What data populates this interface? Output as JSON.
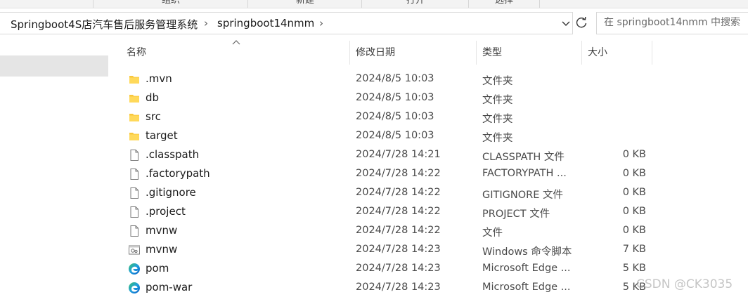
{
  "ribbon": {
    "groups": [
      "组织",
      "新建",
      "打开",
      "选择"
    ]
  },
  "address_bar": {
    "breadcrumbs": [
      "Springboot4S店汽车售后服务管理系统",
      "springboot14nmm"
    ]
  },
  "search": {
    "placeholder": "在 springboot14nmm 中搜索"
  },
  "columns": {
    "name": "名称",
    "date": "修改日期",
    "type": "类型",
    "size": "大小"
  },
  "files": [
    {
      "name": ".mvn",
      "date": "2024/8/5 10:03",
      "type": "文件夹",
      "size": "",
      "icon": "folder-icon"
    },
    {
      "name": "db",
      "date": "2024/8/5 10:03",
      "type": "文件夹",
      "size": "",
      "icon": "folder-icon"
    },
    {
      "name": "src",
      "date": "2024/8/5 10:03",
      "type": "文件夹",
      "size": "",
      "icon": "folder-icon"
    },
    {
      "name": "target",
      "date": "2024/8/5 10:03",
      "type": "文件夹",
      "size": "",
      "icon": "folder-icon"
    },
    {
      "name": ".classpath",
      "date": "2024/7/28 14:21",
      "type": "CLASSPATH 文件",
      "size": "0 KB",
      "icon": "file-icon"
    },
    {
      "name": ".factorypath",
      "date": "2024/7/28 14:22",
      "type": "FACTORYPATH ...",
      "size": "0 KB",
      "icon": "file-icon"
    },
    {
      "name": ".gitignore",
      "date": "2024/7/28 14:22",
      "type": "GITIGNORE 文件",
      "size": "0 KB",
      "icon": "file-icon"
    },
    {
      "name": ".project",
      "date": "2024/7/28 14:22",
      "type": "PROJECT 文件",
      "size": "0 KB",
      "icon": "file-icon"
    },
    {
      "name": "mvnw",
      "date": "2024/7/28 14:22",
      "type": "文件",
      "size": "0 KB",
      "icon": "file-icon"
    },
    {
      "name": "mvnw",
      "date": "2024/7/28 14:23",
      "type": "Windows 命令脚本",
      "size": "7 KB",
      "icon": "script-icon"
    },
    {
      "name": "pom",
      "date": "2024/7/28 14:23",
      "type": "Microsoft Edge ...",
      "size": "5 KB",
      "icon": "edge-icon"
    },
    {
      "name": "pom-war",
      "date": "2024/7/28 14:23",
      "type": "Microsoft Edge ...",
      "size": "5 KB",
      "icon": "edge-icon"
    }
  ],
  "watermark": "CSDN @CK3035",
  "colors": {
    "folder": "#f8c73c",
    "selection": "#e5e5e5",
    "edge_blue": "#0c6fd0",
    "edge_green": "#3cc26b"
  }
}
